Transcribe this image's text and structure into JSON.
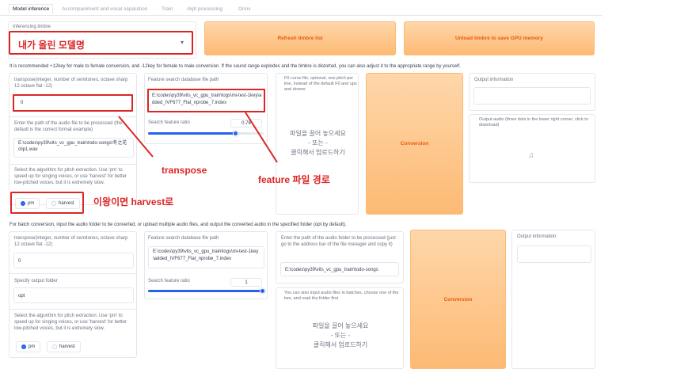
{
  "tabs": [
    "Model inference",
    "Accompaniment and vocal separation",
    "Train",
    "ckpt processing",
    "Onnx"
  ],
  "timbre": {
    "label": "Inferencing timbre",
    "selected": "내가 올린 모델명",
    "refresh_button": "Refresh timbre list",
    "unload_button": "Unload timbre to save GPU memory"
  },
  "single": {
    "note": "It is recommended +12key for male to female conversion, and -12key for female to male conversion. If the sound range explodes and the timbre is distorted, you can also adjust it to the appropriate range by yourself.",
    "transpose_label": "transpose(integer, number of semitones, octave sharp 12 octave flat -12)",
    "transpose_value": "0",
    "audio_path_label": "Enter the path of the audio file to be processed (the default is the correct format example)",
    "audio_path_value": "E:\\codes\\py39\\vits_vc_gpu_train\\todo-songs\\冬之花clip1.wav",
    "algo_label": "Select the algorithm for pitch extraction. Use 'pm' to speed up for singing voices, or use 'harvest' for better low-pitched voices, but it is extremely slow.",
    "algo_pm": "pm",
    "algo_harvest": "harvest",
    "feature_path_label": "Feature search database file path",
    "feature_path_value": "E:\\codes\\py39\\vits_vc_gpu_train\\logs\\mi-test-1key\\added_IVF677_Flat_nprobe_7.index",
    "ratio_label": "Search feature ratio",
    "ratio_value": "0.76",
    "f0_label": "F0 curve file, optional, one pitch per line, instead of the default F0 and ups and downs",
    "drop_line1": "파일을 끌어 놓으세요",
    "drop_line2": "- 또는 -",
    "drop_line3": "클릭해서 업로드하기",
    "convert_button": "Conversion",
    "output_info_label": "Output information",
    "output_audio_label": "Output audio (three dots in the lower right corner, click to download)"
  },
  "annotations": {
    "transpose": "transpose",
    "feature": "feature 파일 경로",
    "harvest": "이왕이면 harvest로"
  },
  "batch": {
    "note": "For batch conversion, input the audio folder to be converted, or upload multiple audio files, and output the converted audio in the specified folder (opt by default).",
    "transpose_label": "transpose(integer, number of semitones, octave sharp 12 octave flat -12)",
    "transpose_value": "0",
    "output_folder_label": "Specify output folder",
    "output_folder_value": "opt",
    "algo_label": "Select the algorithm for pitch extraction. Use 'pm' to speed up for singing voices, or use 'harvest' for better low-pitched voices, but it is extremely slow.",
    "algo_pm": "pm",
    "algo_harvest": "harvest",
    "feature_path_label": "Feature search database file path",
    "feature_path_value": "E:\\codes\\py39\\vits_vc_gpu_train\\logs\\mi-test-1key\\added_IVF677_Flat_nprobe_7.index",
    "ratio_label": "Search feature ratio",
    "ratio_value": "1",
    "folder_label": "Enter the path of the audio folder to be processed (just go to the address bar of the file manager and copy it)",
    "folder_value": "E:\\codes\\py39\\vits_vc_gpu_train\\todo-songs",
    "upload_label": "You can also input audio files in batches, choose one of the two, and read the folder first",
    "drop_line1": "파일을 끌어 놓으세요",
    "drop_line2": "- 또는 -",
    "drop_line3": "클릭해서 업로드하기",
    "convert_button": "Conversion",
    "output_info_label": "Output information"
  }
}
